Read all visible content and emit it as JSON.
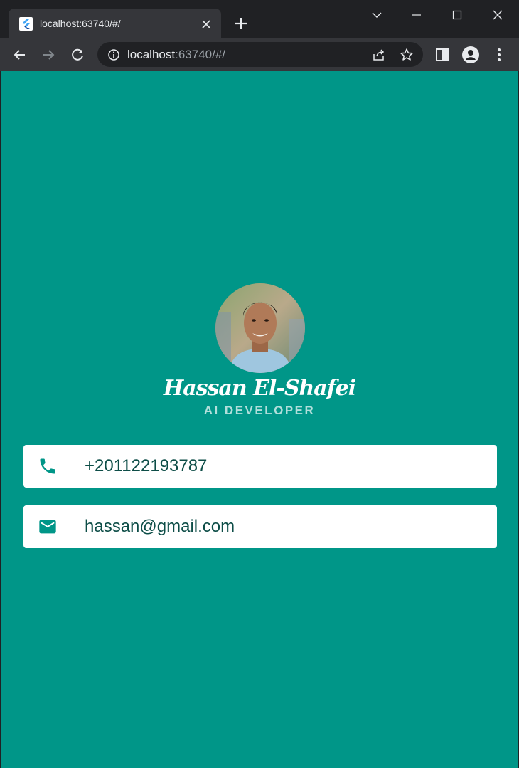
{
  "browser": {
    "tab": {
      "title": "localhost:63740/#/"
    },
    "omnibox": {
      "url_host": "localhost",
      "url_rest": ":63740/#/"
    }
  },
  "profile": {
    "name": "Hassan El-Shafei",
    "title": "AI DEVELOPER",
    "phone": "+201122193787",
    "email": "hassan@gmail.com"
  },
  "colors": {
    "background": "#009688",
    "card": "#ffffff",
    "icon": "#009688",
    "card_text": "#0d4d47",
    "subtitle": "#b2dfdb"
  },
  "icons": {
    "phone": "phone-icon",
    "email": "email-icon"
  }
}
